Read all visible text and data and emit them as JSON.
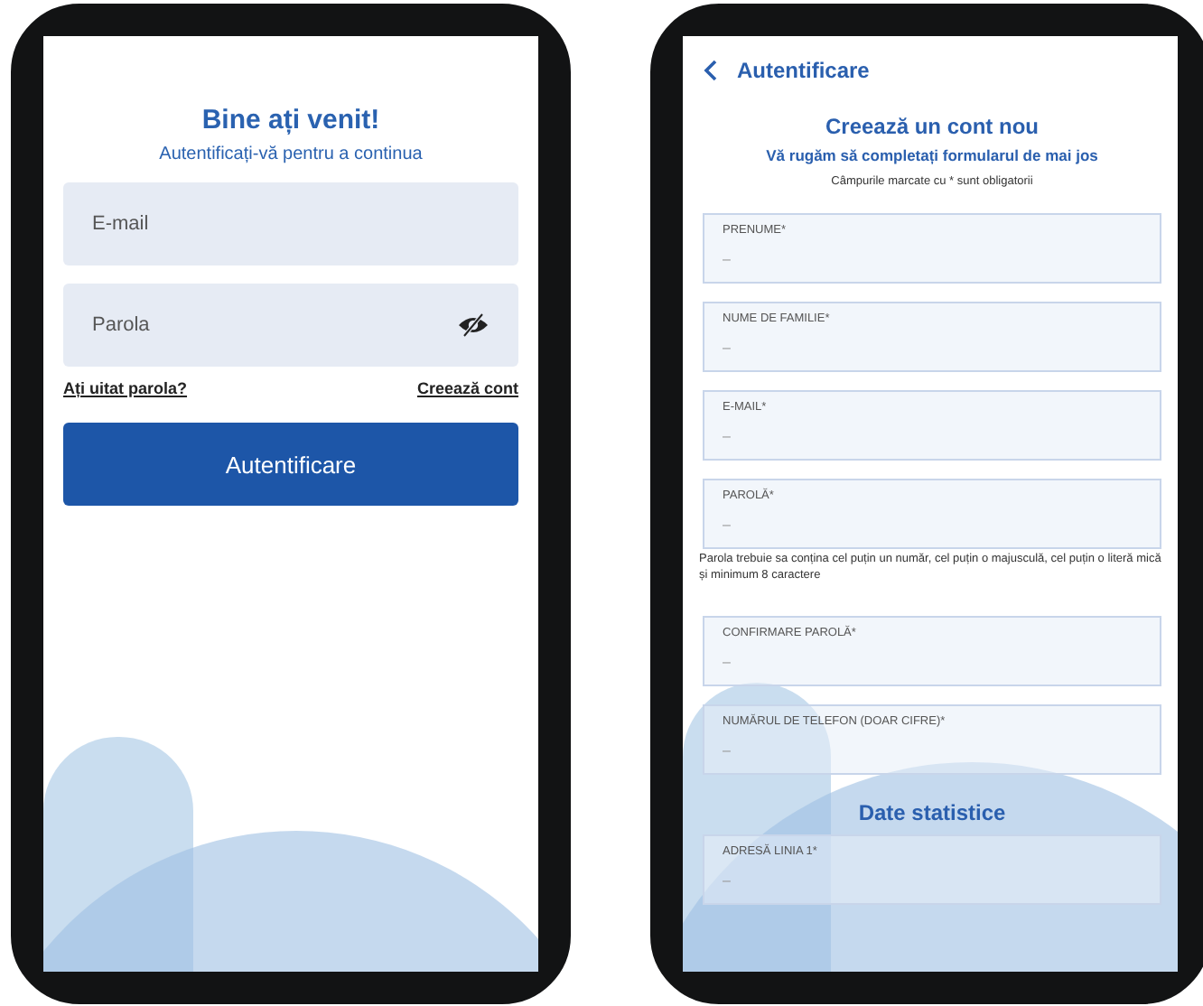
{
  "login_screen": {
    "title": "Bine ați venit!",
    "subtitle": "Autentificați-vă pentru a continua",
    "fields": [
      {
        "kind": "email",
        "placeholder": "E-mail"
      },
      {
        "kind": "password",
        "placeholder": "Parola"
      }
    ],
    "links": [
      "Ați uitat parola?",
      "Creează cont"
    ],
    "button": "Autentificare"
  },
  "register_screen": {
    "back_label": "Autentificare",
    "title": "Creează un cont nou",
    "subtitle": "Vă rugăm să completați formularul de mai jos",
    "required_note": "Câmpurile marcate cu * sunt obligatorii",
    "items": [
      {
        "kind": "field",
        "label": "PRENUME*",
        "placeholder": "–"
      },
      {
        "kind": "field",
        "label": "NUME DE FAMILIE*",
        "placeholder": "–"
      },
      {
        "kind": "field",
        "label": "E-MAIL*",
        "placeholder": "–"
      },
      {
        "kind": "field",
        "label": "PAROLĂ*",
        "placeholder": "–"
      },
      {
        "kind": "hint",
        "text": "Parola trebuie sa conțina cel puțin un număr, cel puțin o majusculă, cel puțin o literă mică și minimum 8 caractere"
      },
      {
        "kind": "field",
        "label": "CONFIRMARE PAROLĂ*",
        "placeholder": "–"
      },
      {
        "kind": "field",
        "label": "NUMĂRUL DE TELEFON (DOAR CIFRE)*",
        "placeholder": "–"
      },
      {
        "kind": "heading",
        "text": "Date statistice"
      },
      {
        "kind": "field",
        "label": "ADRESĂ LINIA 1*",
        "placeholder": "–"
      }
    ]
  }
}
